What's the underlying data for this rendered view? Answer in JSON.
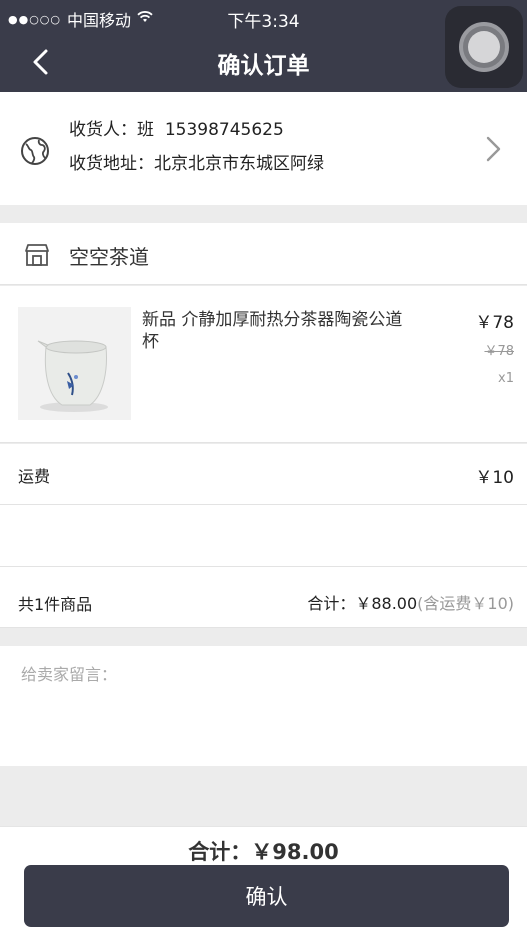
{
  "status_bar": {
    "signal": "●●○○○",
    "carrier": "中国移动",
    "time": "下午3:34"
  },
  "nav": {
    "title": "确认订单",
    "back_icon": "chevron-left-icon"
  },
  "address": {
    "receiver_label": "收货人：",
    "receiver_name": "班",
    "phone": "15398745625",
    "address_label": "收货地址：",
    "address_value": "北京北京市东城区阿绿"
  },
  "shop": {
    "name": "空空茶道",
    "icon": "store-icon"
  },
  "product": {
    "title": "新品  介静加厚耐热分茶器陶瓷公道杯",
    "price": "￥78",
    "original_price": "￥78",
    "quantity": "x1"
  },
  "shipping": {
    "label": "运费",
    "value": "￥10"
  },
  "summary": {
    "count_text": "共1件商品",
    "total_label": "合计：",
    "total_value": "￥88.00",
    "shipping_note": "(含运费￥10)"
  },
  "message": {
    "placeholder": "给卖家留言："
  },
  "footer": {
    "total_label": "合计：",
    "total_value": "￥98.00",
    "confirm_label": "确认"
  },
  "colors": {
    "nav_bg": "#3a3c4a",
    "page_bg": "#ececec",
    "battery": "#4cd964"
  }
}
